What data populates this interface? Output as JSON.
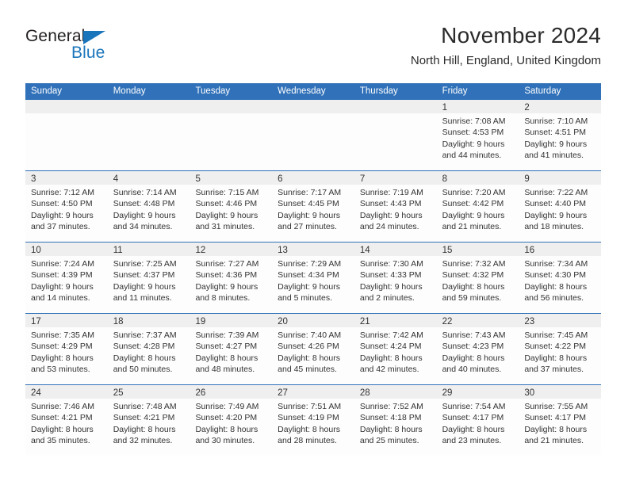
{
  "brand": {
    "name_part1": "General",
    "name_part2": "Blue",
    "accent_color": "#1b75bb"
  },
  "header": {
    "title": "November 2024",
    "location": "North Hill, England, United Kingdom"
  },
  "colors": {
    "header_blue": "#3071b9",
    "day_band_gray": "#efefef",
    "text": "#333333"
  },
  "calendar": {
    "weekdays": [
      "Sunday",
      "Monday",
      "Tuesday",
      "Wednesday",
      "Thursday",
      "Friday",
      "Saturday"
    ],
    "weeks": [
      [
        {
          "day": "",
          "sunrise": "",
          "sunset": "",
          "daylight1": "",
          "daylight2": ""
        },
        {
          "day": "",
          "sunrise": "",
          "sunset": "",
          "daylight1": "",
          "daylight2": ""
        },
        {
          "day": "",
          "sunrise": "",
          "sunset": "",
          "daylight1": "",
          "daylight2": ""
        },
        {
          "day": "",
          "sunrise": "",
          "sunset": "",
          "daylight1": "",
          "daylight2": ""
        },
        {
          "day": "",
          "sunrise": "",
          "sunset": "",
          "daylight1": "",
          "daylight2": ""
        },
        {
          "day": "1",
          "sunrise": "Sunrise: 7:08 AM",
          "sunset": "Sunset: 4:53 PM",
          "daylight1": "Daylight: 9 hours",
          "daylight2": "and 44 minutes."
        },
        {
          "day": "2",
          "sunrise": "Sunrise: 7:10 AM",
          "sunset": "Sunset: 4:51 PM",
          "daylight1": "Daylight: 9 hours",
          "daylight2": "and 41 minutes."
        }
      ],
      [
        {
          "day": "3",
          "sunrise": "Sunrise: 7:12 AM",
          "sunset": "Sunset: 4:50 PM",
          "daylight1": "Daylight: 9 hours",
          "daylight2": "and 37 minutes."
        },
        {
          "day": "4",
          "sunrise": "Sunrise: 7:14 AM",
          "sunset": "Sunset: 4:48 PM",
          "daylight1": "Daylight: 9 hours",
          "daylight2": "and 34 minutes."
        },
        {
          "day": "5",
          "sunrise": "Sunrise: 7:15 AM",
          "sunset": "Sunset: 4:46 PM",
          "daylight1": "Daylight: 9 hours",
          "daylight2": "and 31 minutes."
        },
        {
          "day": "6",
          "sunrise": "Sunrise: 7:17 AM",
          "sunset": "Sunset: 4:45 PM",
          "daylight1": "Daylight: 9 hours",
          "daylight2": "and 27 minutes."
        },
        {
          "day": "7",
          "sunrise": "Sunrise: 7:19 AM",
          "sunset": "Sunset: 4:43 PM",
          "daylight1": "Daylight: 9 hours",
          "daylight2": "and 24 minutes."
        },
        {
          "day": "8",
          "sunrise": "Sunrise: 7:20 AM",
          "sunset": "Sunset: 4:42 PM",
          "daylight1": "Daylight: 9 hours",
          "daylight2": "and 21 minutes."
        },
        {
          "day": "9",
          "sunrise": "Sunrise: 7:22 AM",
          "sunset": "Sunset: 4:40 PM",
          "daylight1": "Daylight: 9 hours",
          "daylight2": "and 18 minutes."
        }
      ],
      [
        {
          "day": "10",
          "sunrise": "Sunrise: 7:24 AM",
          "sunset": "Sunset: 4:39 PM",
          "daylight1": "Daylight: 9 hours",
          "daylight2": "and 14 minutes."
        },
        {
          "day": "11",
          "sunrise": "Sunrise: 7:25 AM",
          "sunset": "Sunset: 4:37 PM",
          "daylight1": "Daylight: 9 hours",
          "daylight2": "and 11 minutes."
        },
        {
          "day": "12",
          "sunrise": "Sunrise: 7:27 AM",
          "sunset": "Sunset: 4:36 PM",
          "daylight1": "Daylight: 9 hours",
          "daylight2": "and 8 minutes."
        },
        {
          "day": "13",
          "sunrise": "Sunrise: 7:29 AM",
          "sunset": "Sunset: 4:34 PM",
          "daylight1": "Daylight: 9 hours",
          "daylight2": "and 5 minutes."
        },
        {
          "day": "14",
          "sunrise": "Sunrise: 7:30 AM",
          "sunset": "Sunset: 4:33 PM",
          "daylight1": "Daylight: 9 hours",
          "daylight2": "and 2 minutes."
        },
        {
          "day": "15",
          "sunrise": "Sunrise: 7:32 AM",
          "sunset": "Sunset: 4:32 PM",
          "daylight1": "Daylight: 8 hours",
          "daylight2": "and 59 minutes."
        },
        {
          "day": "16",
          "sunrise": "Sunrise: 7:34 AM",
          "sunset": "Sunset: 4:30 PM",
          "daylight1": "Daylight: 8 hours",
          "daylight2": "and 56 minutes."
        }
      ],
      [
        {
          "day": "17",
          "sunrise": "Sunrise: 7:35 AM",
          "sunset": "Sunset: 4:29 PM",
          "daylight1": "Daylight: 8 hours",
          "daylight2": "and 53 minutes."
        },
        {
          "day": "18",
          "sunrise": "Sunrise: 7:37 AM",
          "sunset": "Sunset: 4:28 PM",
          "daylight1": "Daylight: 8 hours",
          "daylight2": "and 50 minutes."
        },
        {
          "day": "19",
          "sunrise": "Sunrise: 7:39 AM",
          "sunset": "Sunset: 4:27 PM",
          "daylight1": "Daylight: 8 hours",
          "daylight2": "and 48 minutes."
        },
        {
          "day": "20",
          "sunrise": "Sunrise: 7:40 AM",
          "sunset": "Sunset: 4:26 PM",
          "daylight1": "Daylight: 8 hours",
          "daylight2": "and 45 minutes."
        },
        {
          "day": "21",
          "sunrise": "Sunrise: 7:42 AM",
          "sunset": "Sunset: 4:24 PM",
          "daylight1": "Daylight: 8 hours",
          "daylight2": "and 42 minutes."
        },
        {
          "day": "22",
          "sunrise": "Sunrise: 7:43 AM",
          "sunset": "Sunset: 4:23 PM",
          "daylight1": "Daylight: 8 hours",
          "daylight2": "and 40 minutes."
        },
        {
          "day": "23",
          "sunrise": "Sunrise: 7:45 AM",
          "sunset": "Sunset: 4:22 PM",
          "daylight1": "Daylight: 8 hours",
          "daylight2": "and 37 minutes."
        }
      ],
      [
        {
          "day": "24",
          "sunrise": "Sunrise: 7:46 AM",
          "sunset": "Sunset: 4:21 PM",
          "daylight1": "Daylight: 8 hours",
          "daylight2": "and 35 minutes."
        },
        {
          "day": "25",
          "sunrise": "Sunrise: 7:48 AM",
          "sunset": "Sunset: 4:21 PM",
          "daylight1": "Daylight: 8 hours",
          "daylight2": "and 32 minutes."
        },
        {
          "day": "26",
          "sunrise": "Sunrise: 7:49 AM",
          "sunset": "Sunset: 4:20 PM",
          "daylight1": "Daylight: 8 hours",
          "daylight2": "and 30 minutes."
        },
        {
          "day": "27",
          "sunrise": "Sunrise: 7:51 AM",
          "sunset": "Sunset: 4:19 PM",
          "daylight1": "Daylight: 8 hours",
          "daylight2": "and 28 minutes."
        },
        {
          "day": "28",
          "sunrise": "Sunrise: 7:52 AM",
          "sunset": "Sunset: 4:18 PM",
          "daylight1": "Daylight: 8 hours",
          "daylight2": "and 25 minutes."
        },
        {
          "day": "29",
          "sunrise": "Sunrise: 7:54 AM",
          "sunset": "Sunset: 4:17 PM",
          "daylight1": "Daylight: 8 hours",
          "daylight2": "and 23 minutes."
        },
        {
          "day": "30",
          "sunrise": "Sunrise: 7:55 AM",
          "sunset": "Sunset: 4:17 PM",
          "daylight1": "Daylight: 8 hours",
          "daylight2": "and 21 minutes."
        }
      ]
    ]
  }
}
